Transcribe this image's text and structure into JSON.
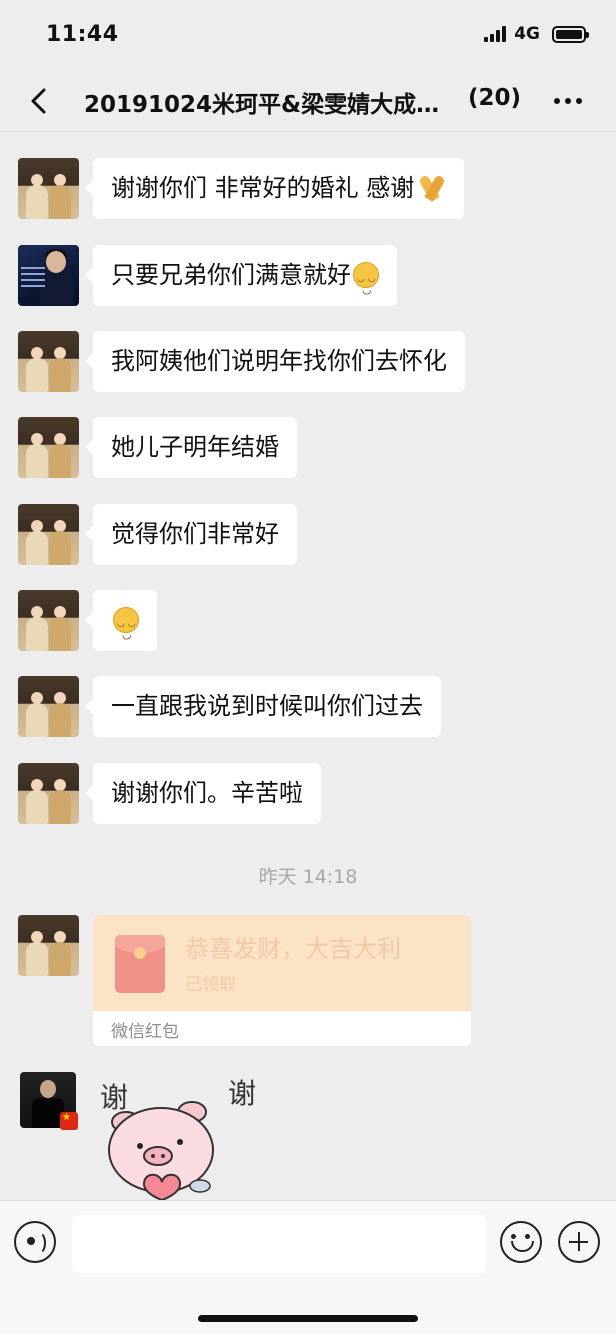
{
  "status_bar": {
    "time": "11:44",
    "network": "4G"
  },
  "nav": {
    "title": "20191024米珂平&梁雯婧大成…",
    "member_count": "(20)"
  },
  "messages": [
    {
      "text": "谢谢你们 非常好的婚礼 感谢",
      "emoji": "pray-icon"
    },
    {
      "text": "只要兄弟你们满意就好",
      "emoji": "smile-icon"
    },
    {
      "text": "我阿姨他们说明年找你们去怀化"
    },
    {
      "text": "她儿子明年结婚"
    },
    {
      "text": "觉得你们非常好"
    },
    {
      "text": "",
      "emoji": "smile-icon"
    },
    {
      "text": "一直跟我说到时候叫你们过去"
    },
    {
      "text": "谢谢你们。辛苦啦"
    }
  ],
  "timestamp": "昨天 14:18",
  "red_packet": {
    "title": "恭喜发财，大吉大利",
    "status": "已领取",
    "label": "微信红包"
  },
  "sticker": {
    "left_text": "谢",
    "right_text": "谢"
  },
  "input": {
    "placeholder": ""
  },
  "colors": {
    "background": "#ededed",
    "bubble": "#ffffff",
    "red_packet": "#fbe4c6"
  }
}
